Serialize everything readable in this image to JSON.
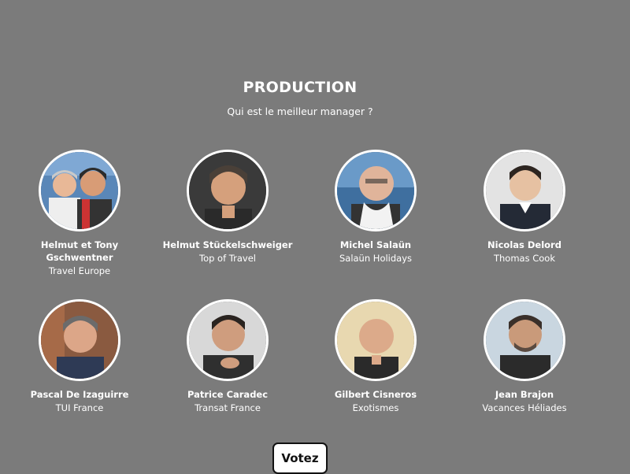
{
  "section": {
    "title": "PRODUCTION",
    "subtitle": "Qui est le meilleur manager ?"
  },
  "managers": [
    {
      "name": "Helmut et Tony Gschwentner",
      "company": "Travel Europe",
      "icon": "two-men-portrait"
    },
    {
      "name": "Helmut Stückelschweiger",
      "company": "Top of Travel",
      "icon": "man-portrait"
    },
    {
      "name": "Michel Salaün",
      "company": "Salaün Holidays",
      "icon": "man-portrait"
    },
    {
      "name": "Nicolas Delord",
      "company": "Thomas Cook",
      "icon": "man-portrait"
    },
    {
      "name": "Pascal De Izaguirre",
      "company": "TUI France",
      "icon": "man-portrait"
    },
    {
      "name": "Patrice Caradec",
      "company": "Transat France",
      "icon": "man-portrait"
    },
    {
      "name": "Gilbert Cisneros",
      "company": "Exotismes",
      "icon": "man-portrait"
    },
    {
      "name": "Jean Brajon",
      "company": "Vacances Héliades",
      "icon": "man-portrait"
    }
  ],
  "vote_button": {
    "label": "Votez"
  },
  "colors": {
    "background": "#7b7b7b",
    "text": "#ffffff",
    "button_bg": "#ffffff",
    "button_text": "#111111"
  }
}
